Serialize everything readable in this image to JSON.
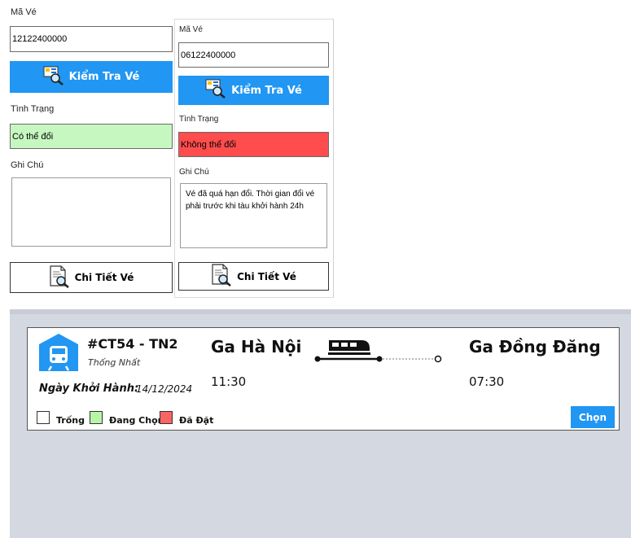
{
  "left_panel": {
    "ticket_label": "Mã Vé",
    "ticket_value": "12122400000",
    "check_button": "Kiểm Tra Vé",
    "status_label": "Tình Trạng",
    "status_value": "Có thể đổi",
    "status_color": "#c6f7c0",
    "note_label": "Ghi Chú",
    "note_value": "",
    "detail_button": "Chi Tiết Vé"
  },
  "right_panel": {
    "ticket_label": "Mã Vé",
    "ticket_value": "06122400000",
    "check_button": "Kiểm Tra Vé",
    "status_label": "Tình Trạng",
    "status_value": "Không thể đổi",
    "status_color": "#ff4d4d",
    "note_label": "Ghi Chú",
    "note_value": "Vé đã quá hạn đổi. Thời gian đổi vé phải trước khi tàu khởi hành 24h",
    "detail_button": "Chi Tiết Vé"
  },
  "trip": {
    "code": "#CT54 - TN2",
    "route_name": "Thống Nhất",
    "departure_label": "Ngày Khởi Hành:",
    "departure_date": "14/12/2024",
    "from_station": "Ga Hà Nội",
    "from_time": "11:30",
    "to_station": "Ga Đồng Đăng",
    "to_time": "07:30",
    "select_button": "Chọn",
    "accent_color": "#2196f3"
  },
  "legend": [
    {
      "label": "Trống",
      "color": "#ffffff"
    },
    {
      "label": "Đang Chọn",
      "color": "#b9f5a9"
    },
    {
      "label": "Đã Đặt",
      "color": "#f86565"
    }
  ],
  "icons": {
    "check": "ticket-search-icon",
    "detail": "document-search-icon",
    "station": "train-station-icon",
    "train": "train-icon"
  }
}
